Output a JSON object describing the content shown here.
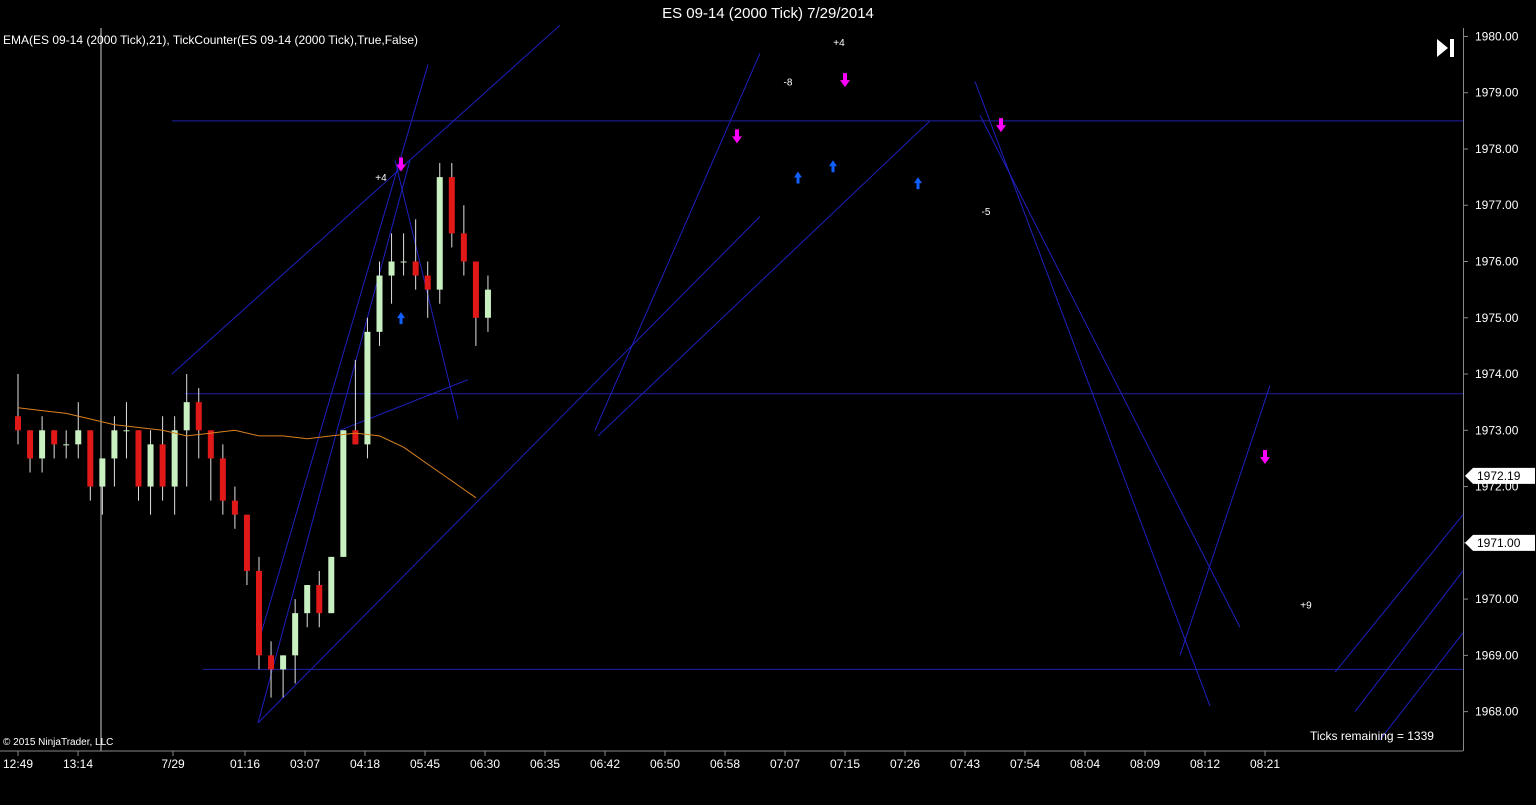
{
  "window": {
    "title": "ES 09-14 (2000 Tick)  7/29/2014"
  },
  "indicators_label": "EMA(ES 09-14 (2000 Tick),21),  TickCounter(ES 09-14 (2000 Tick),True,False)",
  "copyright": "© 2015 NinjaTrader, LLC",
  "ticks_remaining": "Ticks remaining = 1339",
  "colors": {
    "up_candle": "#c8f0c0",
    "down_candle": "#e01818",
    "ema": "#d9821e",
    "trendline": "#1f1fbf",
    "hline": "#1f1fa8",
    "arrow_down": "#ff00ff",
    "arrow_up": "#1060ff",
    "axis": "#888888"
  },
  "chart_data": {
    "type": "candlestick",
    "ylim": [
      1967.3,
      1980.15
    ],
    "y_ticks": [
      "1980.00",
      "1979.00",
      "1978.00",
      "1977.00",
      "1976.00",
      "1975.00",
      "1974.00",
      "1973.00",
      "1972.00",
      "1971.00",
      "1970.00",
      "1969.00",
      "1968.00"
    ],
    "y_tick_values": [
      1980,
      1979,
      1978,
      1977,
      1976,
      1975,
      1974,
      1973,
      1972,
      1971,
      1970,
      1969,
      1968
    ],
    "x_labels": [
      "12:49",
      "13:14",
      "7/29",
      "01:16",
      "03:07",
      "04:18",
      "05:45",
      "06:30",
      "06:35",
      "06:42",
      "06:50",
      "06:58",
      "07:07",
      "07:15",
      "07:26",
      "07:43",
      "07:54",
      "08:04",
      "08:09",
      "08:12",
      "08:21"
    ],
    "x_label_bars": [
      0,
      5,
      12,
      17,
      22,
      27,
      32,
      37,
      42,
      47,
      52,
      57,
      62,
      67,
      72,
      77,
      82,
      87,
      92,
      97,
      102
    ],
    "last_price_label": "1972.19",
    "last_price": 1972.19,
    "current_price_label": "1971.00",
    "current_price": 1971.0,
    "candles": [
      [
        1973.25,
        1974.0,
        1972.75,
        1973.0
      ],
      [
        1973.0,
        1973.0,
        1972.25,
        1972.5
      ],
      [
        1972.5,
        1973.25,
        1972.25,
        1973.0
      ],
      [
        1973.0,
        1973.0,
        1972.5,
        1972.75
      ],
      [
        1972.75,
        1973.0,
        1972.5,
        1972.75
      ],
      [
        1972.75,
        1973.5,
        1972.5,
        1973.0
      ],
      [
        1973.0,
        1973.0,
        1971.75,
        1972.0
      ],
      [
        1972.0,
        1972.5,
        1971.5,
        1972.5
      ],
      [
        1972.5,
        1973.25,
        1972.0,
        1973.0
      ],
      [
        1973.0,
        1973.5,
        1972.5,
        1973.0
      ],
      [
        1973.0,
        1973.0,
        1971.75,
        1972.0
      ],
      [
        1972.0,
        1973.0,
        1971.5,
        1972.75
      ],
      [
        1972.75,
        1973.25,
        1971.75,
        1972.0
      ],
      [
        1972.0,
        1973.25,
        1971.5,
        1973.0
      ],
      [
        1973.0,
        1974.0,
        1972.0,
        1973.5
      ],
      [
        1973.5,
        1973.75,
        1972.5,
        1973.0
      ],
      [
        1973.0,
        1973.0,
        1971.75,
        1972.5
      ],
      [
        1972.5,
        1972.75,
        1971.5,
        1971.75
      ],
      [
        1971.75,
        1972.0,
        1971.25,
        1971.5
      ],
      [
        1971.5,
        1971.5,
        1970.25,
        1970.5
      ],
      [
        1970.5,
        1970.75,
        1968.75,
        1969.0
      ],
      [
        1969.0,
        1969.25,
        1968.25,
        1968.75
      ],
      [
        1968.75,
        1969.0,
        1968.25,
        1969.0
      ],
      [
        1969.0,
        1970.0,
        1968.5,
        1969.75
      ],
      [
        1969.75,
        1970.25,
        1969.5,
        1970.25
      ],
      [
        1970.25,
        1970.5,
        1969.5,
        1969.75
      ],
      [
        1969.75,
        1970.75,
        1969.75,
        1970.75
      ],
      [
        1970.75,
        1973.0,
        1970.75,
        1973.0
      ],
      [
        1973.0,
        1974.25,
        1972.75,
        1972.75
      ],
      [
        1972.75,
        1975.0,
        1972.5,
        1974.75
      ],
      [
        1974.75,
        1976.0,
        1974.5,
        1975.75
      ],
      [
        1975.75,
        1976.5,
        1975.25,
        1976.0
      ],
      [
        1976.0,
        1976.5,
        1975.75,
        1976.0
      ],
      [
        1976.0,
        1976.75,
        1975.5,
        1975.75
      ],
      [
        1975.75,
        1976.0,
        1975.0,
        1975.5
      ],
      [
        1975.5,
        1977.75,
        1975.25,
        1977.5
      ],
      [
        1977.5,
        1977.75,
        1976.25,
        1976.5
      ],
      [
        1976.5,
        1977.0,
        1975.75,
        1976.0
      ],
      [
        1976.0,
        1976.0,
        1974.5,
        1975.0
      ],
      [
        1975.0,
        1975.75,
        1974.75,
        1975.5
      ]
    ],
    "ema": [
      1973.4,
      1973.35,
      1973.3,
      1973.2,
      1973.1,
      1973.05,
      1973.0,
      1972.9,
      1972.95,
      1973.0,
      1972.9,
      1972.9,
      1972.85,
      1972.9,
      1972.95,
      1972.9,
      1972.7,
      1972.4,
      1972.1,
      1971.8
    ]
  },
  "annotations": [
    {
      "text": "+4",
      "series_index": 0
    },
    {
      "text": "-8",
      "series_index": 1
    },
    {
      "text": "+4",
      "series_index": 2
    },
    {
      "text": "-5",
      "series_index": 3
    },
    {
      "text": "+9",
      "series_index": 4
    }
  ]
}
